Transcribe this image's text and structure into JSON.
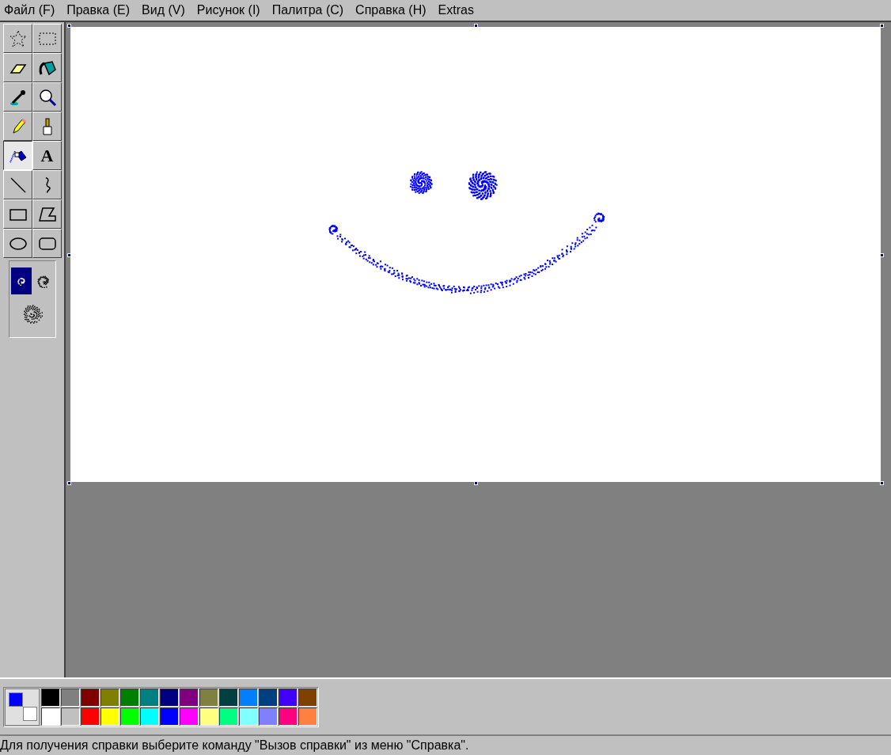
{
  "menu": [
    "Файл (F)",
    "Правка (E)",
    "Вид (V)",
    "Рисунок (I)",
    "Палитра (C)",
    "Справка (H)",
    "Extras"
  ],
  "tools": [
    {
      "kind": "free-select",
      "selected": false
    },
    {
      "kind": "rect-select",
      "selected": false
    },
    {
      "kind": "eraser",
      "selected": false
    },
    {
      "kind": "fill",
      "selected": false
    },
    {
      "kind": "picker",
      "selected": false
    },
    {
      "kind": "magnifier",
      "selected": false
    },
    {
      "kind": "pencil",
      "selected": false
    },
    {
      "kind": "brush",
      "selected": false
    },
    {
      "kind": "airbrush",
      "selected": true
    },
    {
      "kind": "text",
      "selected": false,
      "label": "A"
    },
    {
      "kind": "line",
      "selected": false
    },
    {
      "kind": "curve",
      "selected": false
    },
    {
      "kind": "rectangle",
      "selected": false
    },
    {
      "kind": "polygon",
      "selected": false
    },
    {
      "kind": "ellipse",
      "selected": false
    },
    {
      "kind": "rounded-rect",
      "selected": false
    }
  ],
  "spray_sizes": [
    {
      "selected": true
    },
    {
      "selected": false
    },
    {
      "selected": false
    }
  ],
  "current_colors": [
    {
      "kind": "foreground",
      "color": "#0000ff"
    },
    {
      "kind": "background",
      "color": "#ffffff"
    }
  ],
  "palette": [
    {
      "color": "#000000"
    },
    {
      "color": "#808080"
    },
    {
      "color": "#800000"
    },
    {
      "color": "#808000"
    },
    {
      "color": "#008000"
    },
    {
      "color": "#008080"
    },
    {
      "color": "#000080"
    },
    {
      "color": "#800080"
    },
    {
      "color": "#808040"
    },
    {
      "color": "#004040"
    },
    {
      "color": "#0080ff"
    },
    {
      "color": "#004080"
    },
    {
      "color": "#4000ff"
    },
    {
      "color": "#804000"
    },
    {
      "color": "#ffffff"
    },
    {
      "color": "#c0c0c0"
    },
    {
      "color": "#ff0000"
    },
    {
      "color": "#ffff00"
    },
    {
      "color": "#00ff00"
    },
    {
      "color": "#00ffff"
    },
    {
      "color": "#0000ff"
    },
    {
      "color": "#ff00ff"
    },
    {
      "color": "#ffff80"
    },
    {
      "color": "#00ff80"
    },
    {
      "color": "#80ffff"
    },
    {
      "color": "#8080ff"
    },
    {
      "color": "#ff0080"
    },
    {
      "color": "#ff8040"
    }
  ],
  "status_bar": "Для получения справки выберите команду \"Вызов справки\" из меню \"Справка\"."
}
